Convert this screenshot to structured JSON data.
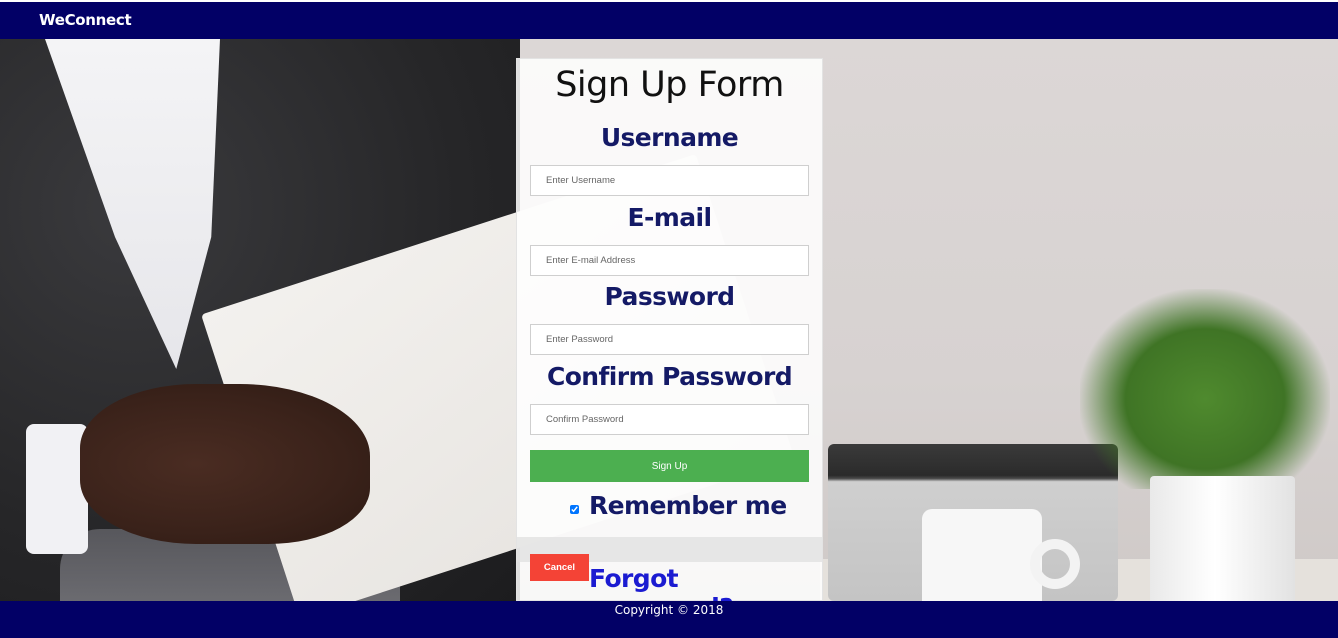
{
  "header": {
    "brand": "WeConnect"
  },
  "form": {
    "title": "Sign Up Form",
    "username": {
      "label": "Username",
      "placeholder": "Enter Username",
      "value": ""
    },
    "email": {
      "label": "E-mail",
      "placeholder": "Enter E-mail Address",
      "value": ""
    },
    "password": {
      "label": "Password",
      "placeholder": "Enter Password",
      "value": ""
    },
    "confirm_password": {
      "label": "Confirm Password",
      "placeholder": "Confirm Password",
      "value": ""
    },
    "signup_label": "Sign Up",
    "remember": {
      "label": "Remember me",
      "checked": true
    },
    "cancel_label": "Cancel",
    "forgot_label": "Forgot password?"
  },
  "footer": {
    "copyright": "Copyright © 2018"
  },
  "colors": {
    "nav_bg": "#020066",
    "label_color": "#141a66",
    "signup_bg": "#4caf50",
    "cancel_bg": "#f44336",
    "link_color": "#1b1bd1"
  }
}
